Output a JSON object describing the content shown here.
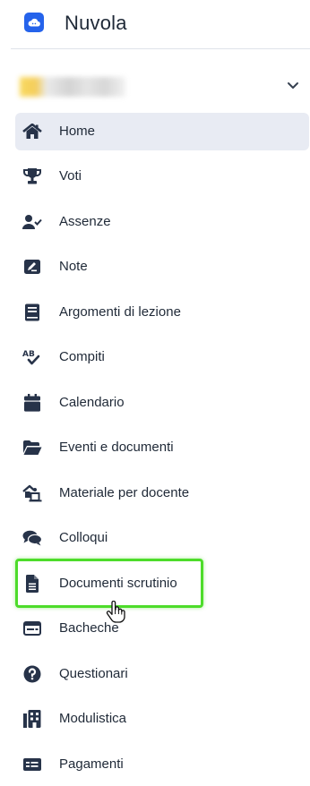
{
  "app": {
    "brand": "Nuvola",
    "logo_icon": "cloud-icon",
    "accent_color": "#2563eb"
  },
  "user_selector": {
    "icon": "chevron-down-icon"
  },
  "nav": {
    "active_background": "#e8ebf3",
    "icon_color": "#273349",
    "items": [
      {
        "label": "Home",
        "icon": "home-icon",
        "active": true
      },
      {
        "label": "Voti",
        "icon": "trophy-icon",
        "active": false
      },
      {
        "label": "Assenze",
        "icon": "user-check-icon",
        "active": false
      },
      {
        "label": "Note",
        "icon": "note-icon",
        "active": false
      },
      {
        "label": "Argomenti di lezione",
        "icon": "book-icon",
        "active": false
      },
      {
        "label": "Compiti",
        "icon": "spellcheck-icon",
        "active": false
      },
      {
        "label": "Calendario",
        "icon": "calendar-icon",
        "active": false
      },
      {
        "label": "Eventi e documenti",
        "icon": "folder-open-icon",
        "active": false
      },
      {
        "label": "Materiale per docente",
        "icon": "teacher-material-icon",
        "active": false
      },
      {
        "label": "Colloqui",
        "icon": "comments-icon",
        "active": false
      },
      {
        "label": "Documenti scrutinio",
        "icon": "file-text-icon",
        "active": false
      },
      {
        "label": "Bacheche",
        "icon": "board-icon",
        "active": false
      },
      {
        "label": "Questionari",
        "icon": "question-circle-icon",
        "active": false
      },
      {
        "label": "Modulistica",
        "icon": "building-form-icon",
        "active": false
      },
      {
        "label": "Pagamenti",
        "icon": "payment-card-icon",
        "active": false
      }
    ]
  },
  "highlight": {
    "target": "Documenti scrutinio",
    "color": "#4ddc2a"
  },
  "cursor": {
    "icon": "hand-pointer-icon"
  }
}
